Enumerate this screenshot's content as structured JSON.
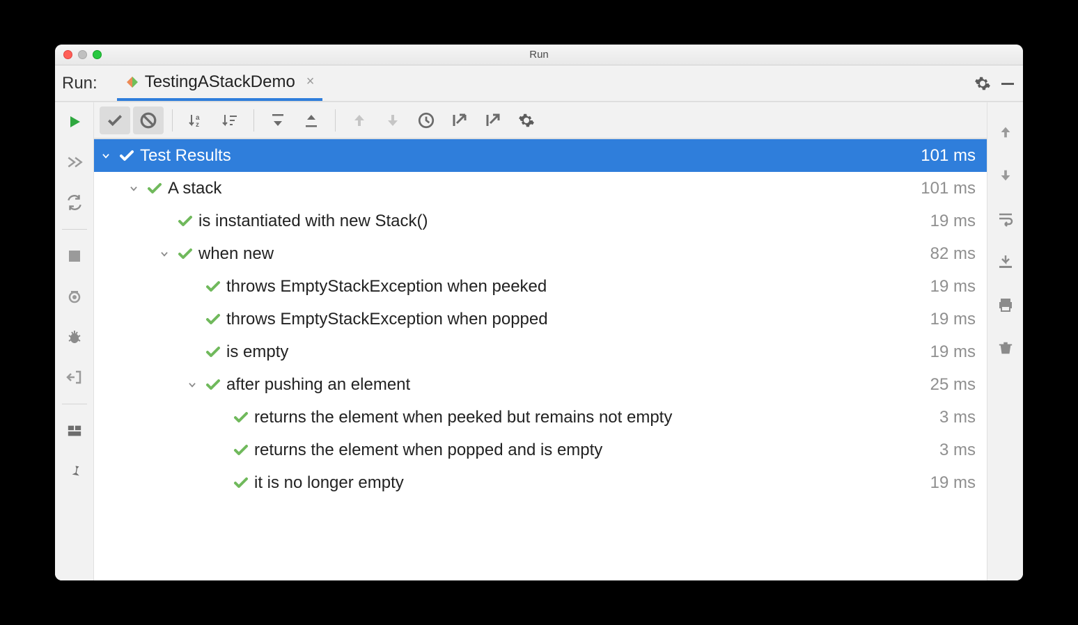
{
  "window": {
    "title": "Run"
  },
  "tabbar": {
    "label": "Run:",
    "tab_name": "TestingAStackDemo"
  },
  "tree": [
    {
      "level": 0,
      "expand": true,
      "label": "Test Results",
      "time": "101 ms",
      "selected": true
    },
    {
      "level": 1,
      "expand": true,
      "label": "A stack",
      "time": "101 ms"
    },
    {
      "level": 2,
      "expand": null,
      "label": "is instantiated with new Stack()",
      "time": "19 ms"
    },
    {
      "level": 2,
      "expand": true,
      "label": "when new",
      "time": "82 ms"
    },
    {
      "level": 3,
      "expand": null,
      "label": "throws EmptyStackException when peeked",
      "time": "19 ms"
    },
    {
      "level": 3,
      "expand": null,
      "label": "throws EmptyStackException when popped",
      "time": "19 ms"
    },
    {
      "level": 3,
      "expand": null,
      "label": "is empty",
      "time": "19 ms"
    },
    {
      "level": 3,
      "expand": true,
      "label": "after pushing an element",
      "time": "25 ms"
    },
    {
      "level": 4,
      "expand": null,
      "label": "returns the element when peeked but remains not empty",
      "time": "3 ms"
    },
    {
      "level": 4,
      "expand": null,
      "label": "returns the element when popped and is empty",
      "time": "3 ms"
    },
    {
      "level": 4,
      "expand": null,
      "label": "it is no longer empty",
      "time": "19 ms"
    }
  ]
}
